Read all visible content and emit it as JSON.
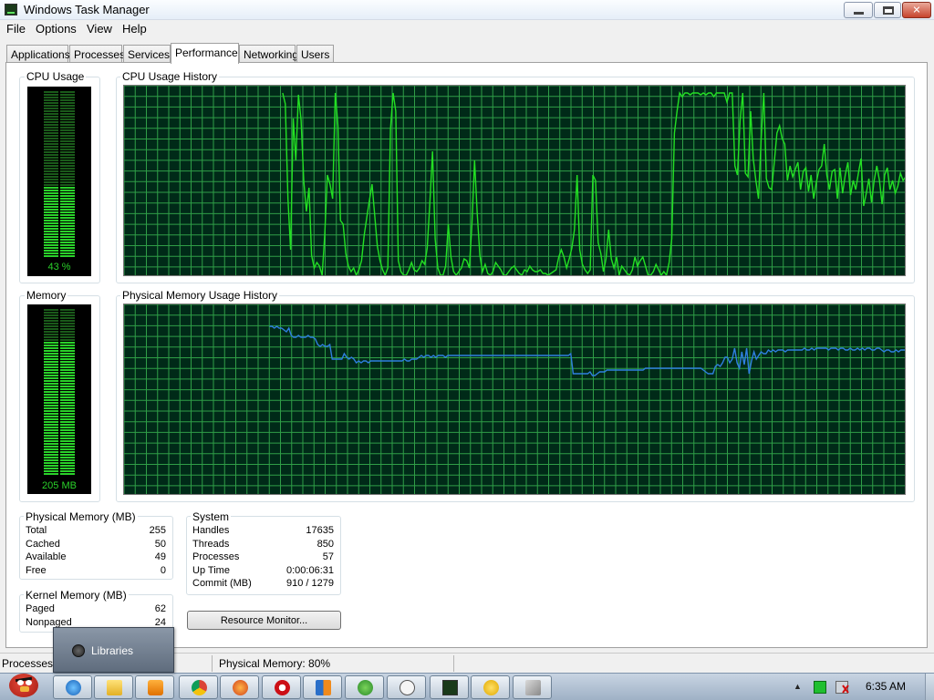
{
  "window": {
    "title": "Windows Task Manager"
  },
  "menu": [
    "File",
    "Options",
    "View",
    "Help"
  ],
  "tabs": [
    "Applications",
    "Processes",
    "Services",
    "Performance",
    "Networking",
    "Users"
  ],
  "active_tab": "Performance",
  "cpu": {
    "label": "CPU Usage",
    "value": "43 %",
    "percent": 43,
    "history_label": "CPU Usage History"
  },
  "memory": {
    "label": "Memory",
    "value": "205 MB",
    "fraction": 0.8,
    "history_label": "Physical Memory Usage History"
  },
  "physical_memory": {
    "title": "Physical Memory (MB)",
    "rows": [
      {
        "label": "Total",
        "value": "255"
      },
      {
        "label": "Cached",
        "value": "50"
      },
      {
        "label": "Available",
        "value": "49"
      },
      {
        "label": "Free",
        "value": "0"
      }
    ]
  },
  "kernel_memory": {
    "title": "Kernel Memory (MB)",
    "rows": [
      {
        "label": "Paged",
        "value": "62"
      },
      {
        "label": "Nonpaged",
        "value": "24"
      }
    ]
  },
  "system": {
    "title": "System",
    "rows": [
      {
        "label": "Handles",
        "value": "17635"
      },
      {
        "label": "Threads",
        "value": "850"
      },
      {
        "label": "Processes",
        "value": "57"
      },
      {
        "label": "Up Time",
        "value": "0:00:06:31"
      },
      {
        "label": "Commit (MB)",
        "value": "910 / 1279"
      }
    ]
  },
  "resource_monitor_button": "Resource Monitor...",
  "statusbar": {
    "processes": "Processes:",
    "physical_memory": "Physical Memory: 80%"
  },
  "popup": {
    "label": "Libraries"
  },
  "taskbar": {
    "clock": "6:35 AM",
    "buttons": [
      "internet-explorer-icon",
      "folder-icon",
      "media-player-icon",
      "chrome-icon",
      "firefox-icon",
      "opera-icon",
      "app-icon",
      "utorrent-icon",
      "messenger-icon",
      "task-manager-icon",
      "smiley-icon",
      "tool-icon"
    ]
  },
  "colors": {
    "graph_bg": "#002a18",
    "grid": "#2f9e47",
    "cpu_line": "#23e023",
    "memory_line": "#2f7fe0",
    "meter_green": "#2ad12a"
  },
  "cpu_history": [
    0,
    0,
    0,
    0,
    0,
    0,
    0,
    0,
    0,
    0,
    0,
    0,
    0,
    0,
    0,
    0,
    0,
    0,
    0,
    0,
    0,
    0,
    0,
    0,
    0,
    0,
    0,
    0,
    0,
    0,
    0,
    0,
    0,
    0,
    0,
    0,
    0,
    0,
    0,
    0,
    0,
    0,
    0,
    0,
    0,
    0,
    0,
    0,
    0,
    0,
    0,
    0,
    0,
    0,
    0,
    0,
    0,
    0,
    0,
    0,
    100,
    94,
    42,
    14,
    86,
    63,
    99,
    85,
    52,
    35,
    48,
    11,
    4,
    7,
    5,
    0,
    22,
    55,
    50,
    42,
    100,
    82,
    30,
    28,
    12,
    5,
    2,
    4,
    0,
    3,
    8,
    22,
    32,
    41,
    50,
    33,
    16,
    8,
    3,
    0,
    4,
    80,
    100,
    90,
    8,
    2,
    0,
    0,
    3,
    7,
    3,
    2,
    4,
    8,
    6,
    15,
    40,
    68,
    20,
    4,
    0,
    0,
    5,
    28,
    10,
    2,
    0,
    2,
    4,
    9,
    8,
    4,
    28,
    63,
    34,
    11,
    2,
    6,
    1,
    0,
    2,
    7,
    5,
    3,
    0,
    0,
    2,
    4,
    5,
    3,
    1,
    0,
    3,
    2,
    5,
    3,
    2,
    2,
    3,
    1,
    1,
    0,
    1,
    2,
    3,
    10,
    14,
    10,
    4,
    9,
    15,
    25,
    55,
    14,
    6,
    3,
    1,
    3,
    55,
    52,
    18,
    12,
    2,
    9,
    25,
    9,
    4,
    10,
    0,
    5,
    3,
    1,
    0,
    3,
    10,
    5,
    8,
    10,
    5,
    0,
    0,
    2,
    6,
    3,
    0,
    2,
    0,
    7,
    20,
    78,
    90,
    100,
    98,
    100,
    100,
    99,
    100,
    100,
    100,
    99,
    100,
    99,
    100,
    100,
    98,
    100,
    100,
    100,
    100,
    95,
    100,
    100,
    60,
    55,
    85,
    100,
    56,
    54,
    90,
    64,
    52,
    42,
    75,
    100,
    53,
    48,
    47,
    62,
    78,
    82,
    75,
    72,
    52,
    60,
    54,
    58,
    62,
    47,
    57,
    59,
    46,
    55,
    42,
    51,
    58,
    60,
    72,
    55,
    47,
    57,
    58,
    42,
    59,
    45,
    55,
    62,
    44,
    52,
    47,
    56,
    64,
    38,
    45,
    53,
    40,
    52,
    60,
    52,
    39,
    55,
    59,
    47,
    52,
    45,
    49,
    56,
    52,
    54
  ],
  "memory_history": [
    0,
    0,
    0,
    0,
    0,
    0,
    0,
    0,
    0,
    0,
    0,
    0,
    0,
    0,
    0,
    0,
    0,
    0,
    0,
    0,
    0,
    0,
    0,
    0,
    0,
    0,
    0,
    0,
    0,
    0,
    0,
    0,
    0,
    0,
    0,
    0,
    0,
    0,
    0,
    0,
    0,
    0,
    0,
    0,
    0,
    0,
    0,
    0,
    0,
    0,
    0,
    0,
    0,
    0,
    0,
    0,
    0,
    0,
    0,
    0,
    92,
    92,
    91,
    92,
    91,
    91,
    90,
    89,
    91,
    87,
    86,
    86,
    87,
    86,
    86,
    86,
    87,
    86,
    86,
    85,
    82,
    81,
    82,
    81,
    81,
    82,
    74,
    74,
    74,
    74,
    74,
    77,
    75,
    74,
    75,
    74,
    72,
    73,
    72,
    73,
    73,
    72,
    73,
    73,
    73,
    73,
    73,
    73,
    73,
    73,
    73,
    73,
    73,
    73,
    73,
    73,
    74,
    73,
    73,
    74,
    74,
    74,
    75,
    76,
    75,
    76,
    76,
    75,
    76,
    75,
    76,
    76,
    76,
    75,
    76,
    76,
    76,
    76,
    76,
    76,
    76,
    76,
    76,
    76,
    76,
    76,
    76,
    76,
    76,
    76,
    76,
    76,
    76,
    76,
    76,
    76,
    76,
    76,
    76,
    76,
    76,
    76,
    76,
    76,
    76,
    76,
    76,
    76,
    76,
    76,
    76,
    76,
    76,
    76,
    76,
    76,
    76,
    76,
    76,
    76,
    76,
    76,
    76,
    76,
    76,
    77,
    66,
    66,
    66,
    66,
    66,
    66,
    66,
    67,
    65,
    65,
    66,
    67,
    67,
    67,
    68,
    68,
    68,
    68,
    68,
    68,
    68,
    68,
    68,
    68,
    68,
    68,
    68,
    68,
    68,
    68,
    69,
    69,
    69,
    69,
    69,
    69,
    69,
    69,
    69,
    69,
    69,
    69,
    69,
    69,
    69,
    69,
    69,
    69,
    69,
    69,
    69,
    69,
    69,
    69,
    68,
    67,
    66,
    66,
    66,
    70,
    71,
    70,
    72,
    75,
    75,
    72,
    74,
    80,
    72,
    69,
    78,
    71,
    80,
    66,
    73,
    78,
    74,
    76,
    78,
    77,
    77,
    79,
    78,
    79,
    78,
    79,
    79,
    79,
    78,
    79,
    79,
    79,
    79,
    79,
    79,
    79,
    80,
    79,
    79,
    80,
    79,
    80,
    80,
    80,
    80,
    80,
    79,
    80,
    80,
    80,
    79,
    80,
    80,
    79,
    79,
    80,
    79,
    79,
    80,
    79,
    80,
    79,
    80,
    80,
    79,
    79,
    80,
    80,
    79,
    78,
    79,
    79,
    78,
    78,
    79,
    78,
    79,
    79,
    79
  ]
}
